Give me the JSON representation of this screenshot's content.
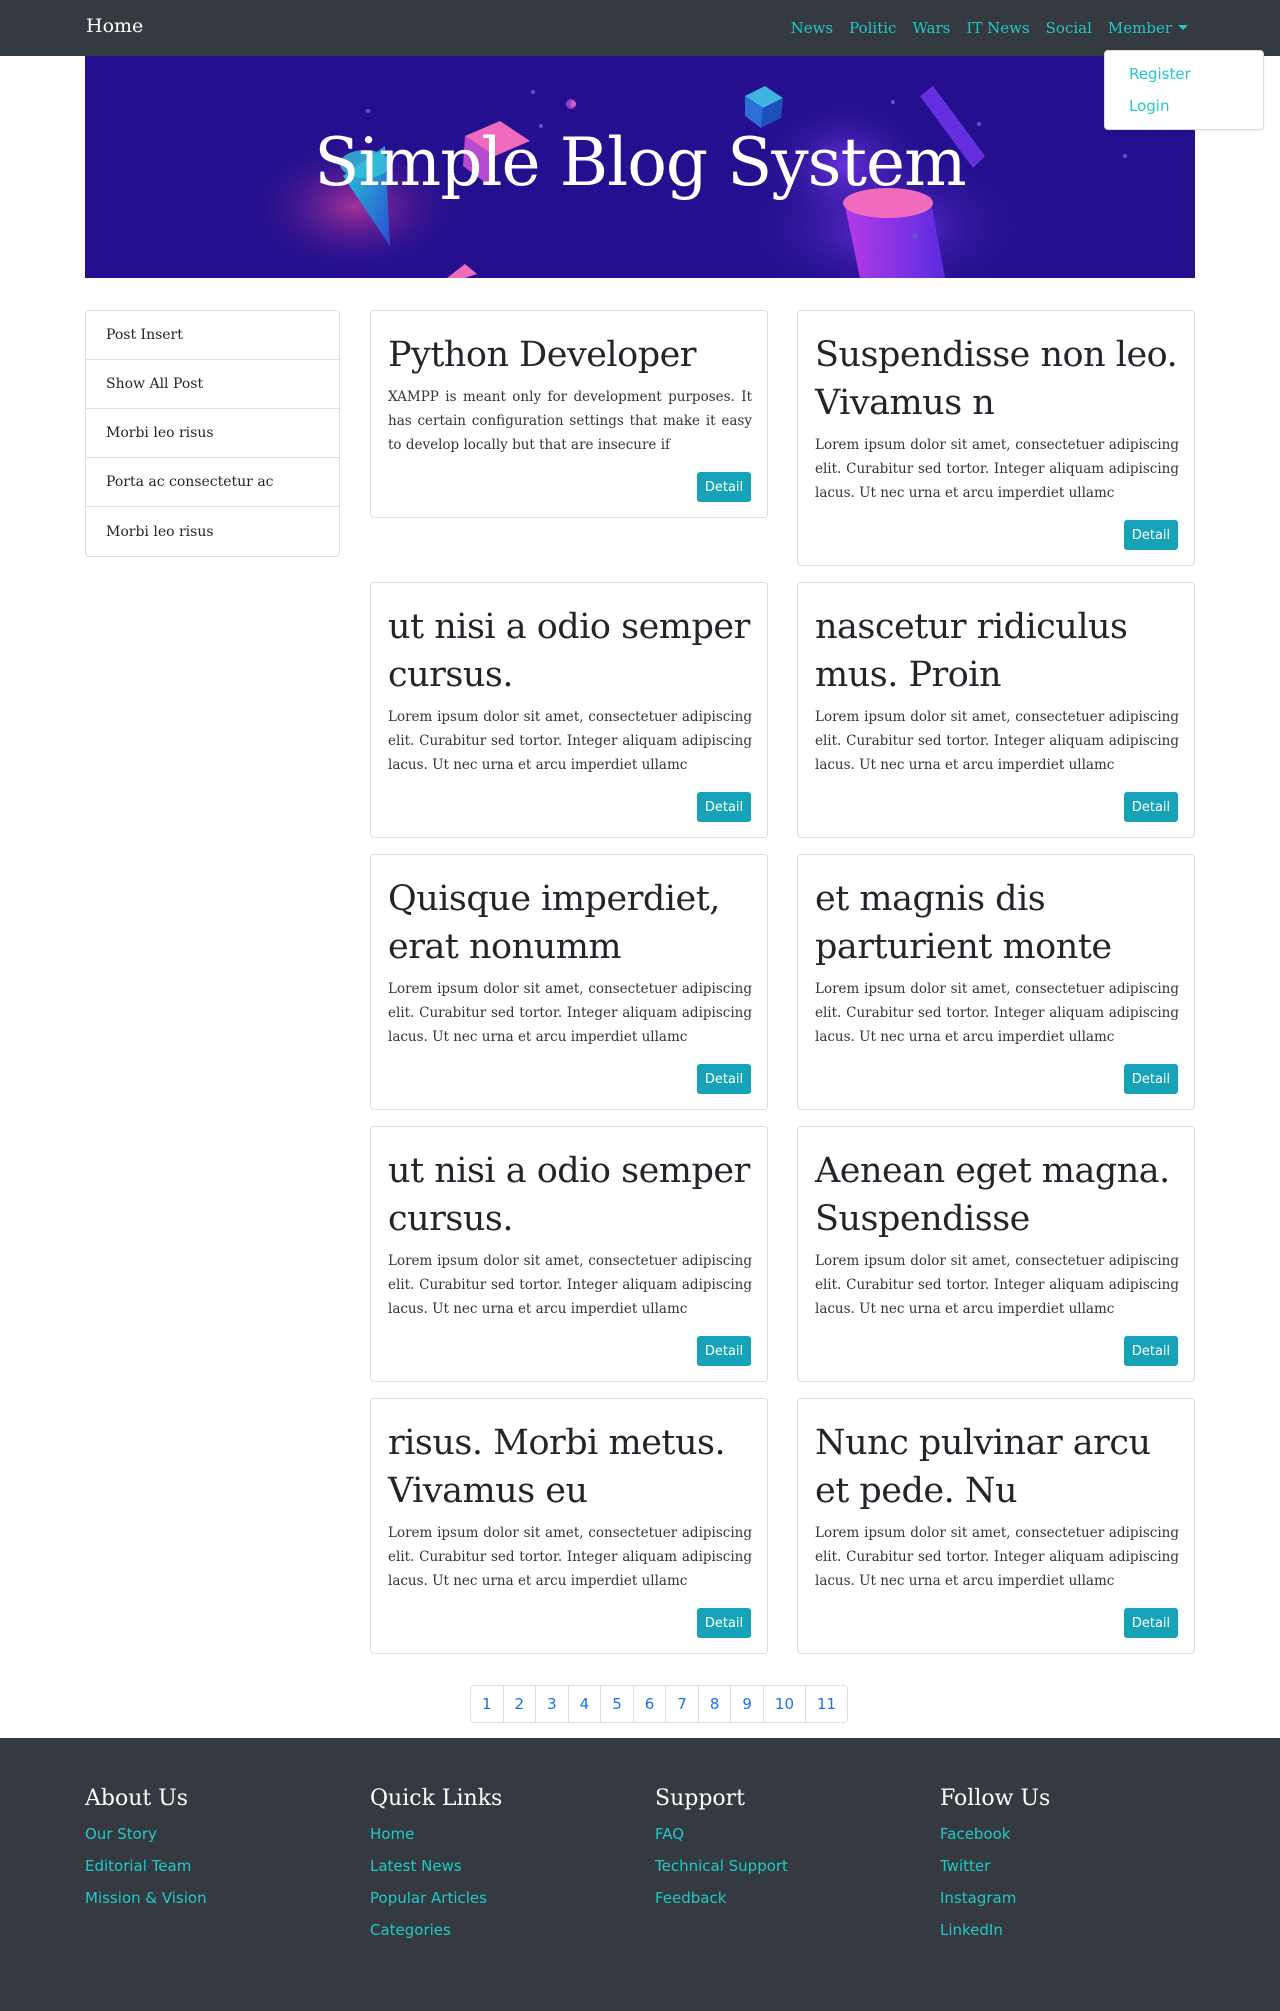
{
  "nav": {
    "brand": "Home",
    "links": [
      "News",
      "Politic",
      "Wars",
      "IT News",
      "Social"
    ],
    "member": "Member",
    "dropdown": [
      "Register",
      "Login"
    ]
  },
  "hero": {
    "title": "Simple Blog System"
  },
  "sidebar": {
    "items": [
      "Post Insert",
      "Show All Post",
      "Morbi leo risus",
      "Porta ac consectetur ac",
      "Morbi leo risus"
    ]
  },
  "posts": [
    {
      "title": "Python Developer",
      "text": "XAMPP is meant only for development purposes. It has certain configuration settings that make it easy to develop locally but that are insecure if",
      "button": "Detail"
    },
    {
      "title": "Suspendisse non leo. Vivamus n",
      "text": "Lorem ipsum dolor sit amet, consectetuer adipiscing elit. Curabitur sed tortor. Integer aliquam adipiscing lacus. Ut nec urna et arcu imperdiet ullamc",
      "button": "Detail"
    },
    {
      "title": "ut nisi a odio semper cursus.",
      "text": "Lorem ipsum dolor sit amet, consectetuer adipiscing elit. Curabitur sed tortor. Integer aliquam adipiscing lacus. Ut nec urna et arcu imperdiet ullamc",
      "button": "Detail"
    },
    {
      "title": "nascetur ridiculus mus. Proin",
      "text": "Lorem ipsum dolor sit amet, consectetuer adipiscing elit. Curabitur sed tortor. Integer aliquam adipiscing lacus. Ut nec urna et arcu imperdiet ullamc",
      "button": "Detail"
    },
    {
      "title": "Quisque imperdiet, erat nonumm",
      "text": "Lorem ipsum dolor sit amet, consectetuer adipiscing elit. Curabitur sed tortor. Integer aliquam adipiscing lacus. Ut nec urna et arcu imperdiet ullamc",
      "button": "Detail"
    },
    {
      "title": "et magnis dis parturient monte",
      "text": "Lorem ipsum dolor sit amet, consectetuer adipiscing elit. Curabitur sed tortor. Integer aliquam adipiscing lacus. Ut nec urna et arcu imperdiet ullamc",
      "button": "Detail"
    },
    {
      "title": "ut nisi a odio semper cursus.",
      "text": "Lorem ipsum dolor sit amet, consectetuer adipiscing elit. Curabitur sed tortor. Integer aliquam adipiscing lacus. Ut nec urna et arcu imperdiet ullamc",
      "button": "Detail"
    },
    {
      "title": "Aenean eget magna. Suspendisse",
      "text": "Lorem ipsum dolor sit amet, consectetuer adipiscing elit. Curabitur sed tortor. Integer aliquam adipiscing lacus. Ut nec urna et arcu imperdiet ullamc",
      "button": "Detail"
    },
    {
      "title": "risus. Morbi metus. Vivamus eu",
      "text": "Lorem ipsum dolor sit amet, consectetuer adipiscing elit. Curabitur sed tortor. Integer aliquam adipiscing lacus. Ut nec urna et arcu imperdiet ullamc",
      "button": "Detail"
    },
    {
      "title": "Nunc pulvinar arcu et pede. Nu",
      "text": "Lorem ipsum dolor sit amet, consectetuer adipiscing elit. Curabitur sed tortor. Integer aliquam adipiscing lacus. Ut nec urna et arcu imperdiet ullamc",
      "button": "Detail"
    }
  ],
  "pagination": [
    "1",
    "2",
    "3",
    "4",
    "5",
    "6",
    "7",
    "8",
    "9",
    "10",
    "11"
  ],
  "footer": {
    "columns": [
      {
        "heading": "About Us",
        "links": [
          "Our Story",
          "Editorial Team",
          "Mission & Vision"
        ]
      },
      {
        "heading": "Quick Links",
        "links": [
          "Home",
          "Latest News",
          "Popular Articles",
          "Categories"
        ]
      },
      {
        "heading": "Support",
        "links": [
          "FAQ",
          "Technical Support",
          "Feedback"
        ]
      },
      {
        "heading": "Follow Us",
        "links": [
          "Facebook",
          "Twitter",
          "Instagram",
          "LinkedIn"
        ]
      }
    ]
  },
  "colors": {
    "nav_bg": "#343a40",
    "accent": "#20c9c9",
    "button": "#17a2b8",
    "hero_bg": "#24108e",
    "link": "#1a73e8"
  }
}
